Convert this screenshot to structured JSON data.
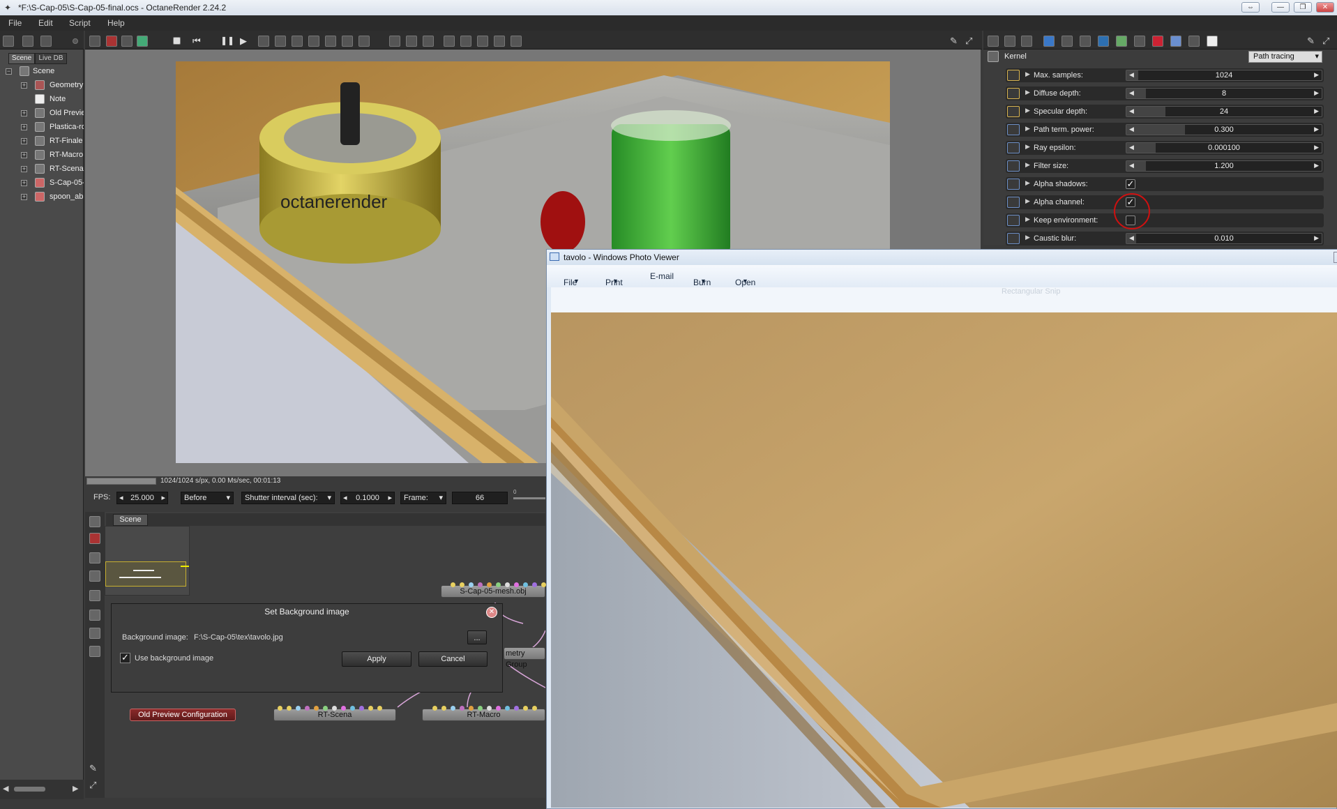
{
  "window": {
    "title": "*F:\\S-Cap-05\\S-Cap-05-final.ocs - OctaneRender 2.24.2",
    "controls": [
      "⇔",
      "—",
      "❐",
      "✕"
    ]
  },
  "menu": [
    "File",
    "Edit",
    "Script",
    "Help"
  ],
  "left": {
    "tabs": [
      "Scene",
      "Live DB"
    ],
    "root": "Scene",
    "items": [
      "Geometry",
      "Note",
      "Old Previe",
      "Plastica-ro",
      "RT-Finale",
      "RT-Macro",
      "RT-Scena",
      "S-Cap-05-",
      "spoon_ab"
    ]
  },
  "render": {
    "brand_text": "octanerender"
  },
  "status": {
    "progress": 1.0,
    "text": "1024/1024 s/px, 0.00 Ms/sec, 00:01:13"
  },
  "fpsbar": {
    "fps_label": "FPS:",
    "fps": "25.000",
    "before": "Before",
    "shutter": "Shutter interval (sec):",
    "shutter_val": "0.1000",
    "frame_label": "Frame:",
    "frame": "66",
    "slider_tick": "0"
  },
  "graph": {
    "tab": "Scene",
    "nodes": {
      "mesh": "S-Cap-05-mesh.obj",
      "group": "Geometry Group",
      "group_short": "metry Group",
      "scena": "RT-Scena",
      "macro": "RT-Macro",
      "old": "Old Preview Configuration"
    }
  },
  "dialog": {
    "title": "Set Background image",
    "bg_label": "Background image:",
    "bg_path": "F:\\S-Cap-05\\tex\\tavolo.jpg",
    "browse": "...",
    "use_label": "Use background image",
    "use_checked": true,
    "apply": "Apply",
    "cancel": "Cancel"
  },
  "kernel": {
    "label": "Kernel",
    "type": "Path tracing",
    "rows": [
      {
        "label": "Max. samples:",
        "value": "1024",
        "fill": 0.06,
        "kind": "slider",
        "tog": "y"
      },
      {
        "label": "Diffuse depth:",
        "value": "8",
        "fill": 0.1,
        "kind": "slider",
        "tog": "y"
      },
      {
        "label": "Specular depth:",
        "value": "24",
        "fill": 0.2,
        "kind": "slider",
        "tog": "y"
      },
      {
        "label": "Path term. power:",
        "value": "0.300",
        "fill": 0.3,
        "kind": "slider",
        "tog": "b"
      },
      {
        "label": "Ray epsilon:",
        "value": "0.000100",
        "fill": 0.15,
        "kind": "slider",
        "tog": "b"
      },
      {
        "label": "Filter size:",
        "value": "1.200",
        "fill": 0.1,
        "kind": "slider",
        "tog": "b"
      },
      {
        "label": "Alpha shadows:",
        "checked": true,
        "kind": "check",
        "tog": "b"
      },
      {
        "label": "Alpha channel:",
        "checked": true,
        "kind": "check",
        "tog": "b"
      },
      {
        "label": "Keep environment:",
        "checked": false,
        "kind": "check",
        "tog": "b"
      },
      {
        "label": "Caustic blur:",
        "value": "0.010",
        "fill": 0.05,
        "kind": "slider",
        "tog": "b"
      }
    ]
  },
  "photoviewer": {
    "title": "tavolo - Windows Photo Viewer",
    "menu": [
      "File",
      "Print",
      "E-mail",
      "Burn",
      "Open"
    ],
    "ghost": "Rectangular Snip"
  }
}
